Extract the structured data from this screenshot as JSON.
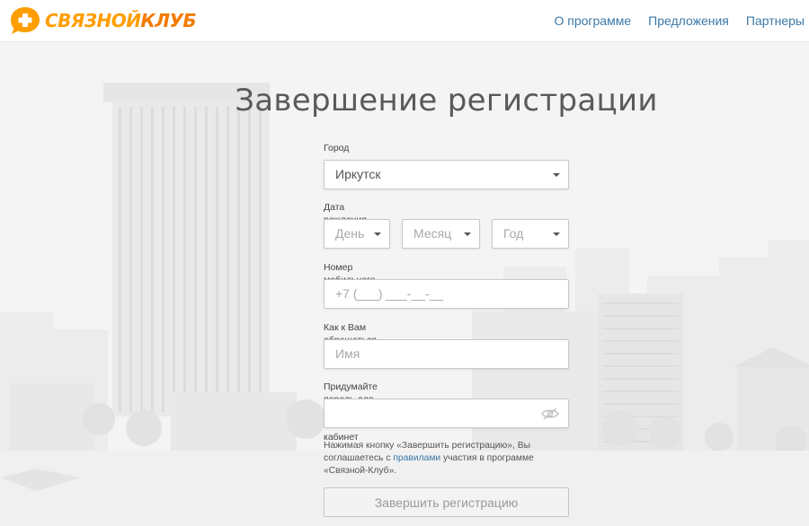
{
  "header": {
    "logo_word1": "СВЯЗНОЙ",
    "logo_word2": "КЛУБ",
    "nav": [
      "О программе",
      "Предложения",
      "Партнеры"
    ]
  },
  "page": {
    "title": "Завершение регистрации"
  },
  "form": {
    "city": {
      "label": "Город",
      "value": "Иркутск"
    },
    "birthdate": {
      "label": "Дата рождения",
      "day": "День",
      "month": "Месяц",
      "year": "Год"
    },
    "phone": {
      "label": "Номер мобильного телефона",
      "placeholder": "+7 (___) ___-__-__"
    },
    "name": {
      "label": "Как к Вам обращаться",
      "placeholder": "Имя"
    },
    "password": {
      "label": "Придумайте пароль для входа в личный кабинет",
      "icon": "eye-off-icon"
    },
    "agreement": {
      "before": "Нажимая кнопку «Завершить регистрацию», Вы соглашаетесь с ",
      "link": "правилами",
      "after": " участия в программе «Связной-Клуб»."
    },
    "submit_label": "Завершить регистрацию"
  },
  "colors": {
    "brand_orange": "#f47b00",
    "brand_yellow": "#ff9e00",
    "link": "#3b78a8",
    "background": "#f4f4f4"
  }
}
